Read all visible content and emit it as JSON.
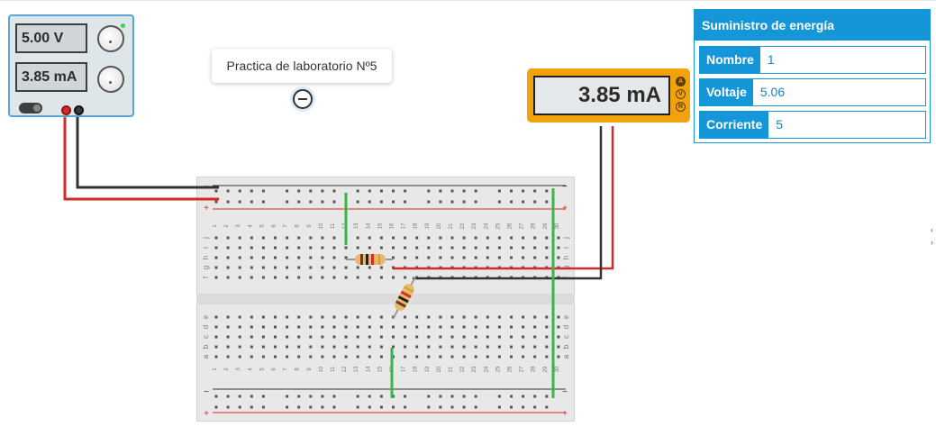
{
  "power_supply": {
    "voltage_display": "5.00 V",
    "current_display": "3.85 mA"
  },
  "note": {
    "text": "Practica de laboratorio Nº5"
  },
  "multimeter": {
    "display": "3.85 mA",
    "modes": [
      "A",
      "V",
      "R"
    ],
    "active_mode": "A"
  },
  "inspector": {
    "title": "Suministro de energía",
    "fields": [
      {
        "label": "Nombre",
        "value": "1"
      },
      {
        "label": "Voltaje",
        "value": "5.06"
      },
      {
        "label": "Corriente",
        "value": "5"
      }
    ]
  },
  "breadboard": {
    "column_numbers": [
      "1",
      "2",
      "3",
      "4",
      "5",
      "6",
      "7",
      "8",
      "9",
      "10",
      "11",
      "12",
      "13",
      "14",
      "15",
      "16",
      "17",
      "18",
      "19",
      "20",
      "21",
      "22",
      "23",
      "24",
      "25",
      "26",
      "27",
      "28",
      "29",
      "30"
    ],
    "top_rows": [
      "j",
      "i",
      "h",
      "g",
      "f"
    ],
    "bottom_rows": [
      "e",
      "d",
      "c",
      "b",
      "a"
    ],
    "rail_minus": "−",
    "rail_plus": "+"
  },
  "colors": {
    "wire_red": "#d32a2a",
    "wire_black": "#333333",
    "wire_green": "#3cb44b",
    "accent_blue": "#1596d9",
    "multimeter_body": "#f2a20a"
  }
}
